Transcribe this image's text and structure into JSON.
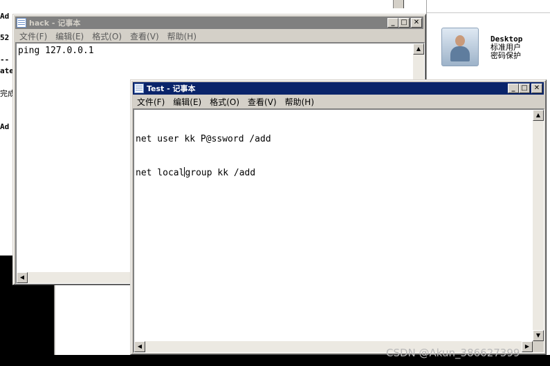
{
  "background": {
    "console_lines": [
      "Ad",
      "52",
      "--",
      "ate",
      "完成",
      "Ad"
    ]
  },
  "hack_window": {
    "title": "hack - 记事本",
    "menu": [
      "文件(F)",
      "编辑(E)",
      "格式(O)",
      "查看(V)",
      "帮助(H)"
    ],
    "content": "ping 127.0.0.1"
  },
  "test_window": {
    "title": "Test - 记事本",
    "menu": [
      "文件(F)",
      "编辑(E)",
      "格式(O)",
      "查看(V)",
      "帮助(H)"
    ],
    "line1": "net user kk P@ssword /add",
    "line2_before_caret": "net local",
    "line2_after_caret": "group kk /add"
  },
  "window_buttons": {
    "minimize": "_",
    "maximize": "□",
    "close": "✕"
  },
  "scroll_arrows": {
    "up": "▲",
    "down": "▼",
    "left": "◀",
    "right": "▶"
  },
  "user_panel": {
    "name": "Desktop",
    "role": "标准用户",
    "status": "密码保护",
    "icon": "user-avatar-icon"
  },
  "watermark": "CSDN @Akun_386627399"
}
